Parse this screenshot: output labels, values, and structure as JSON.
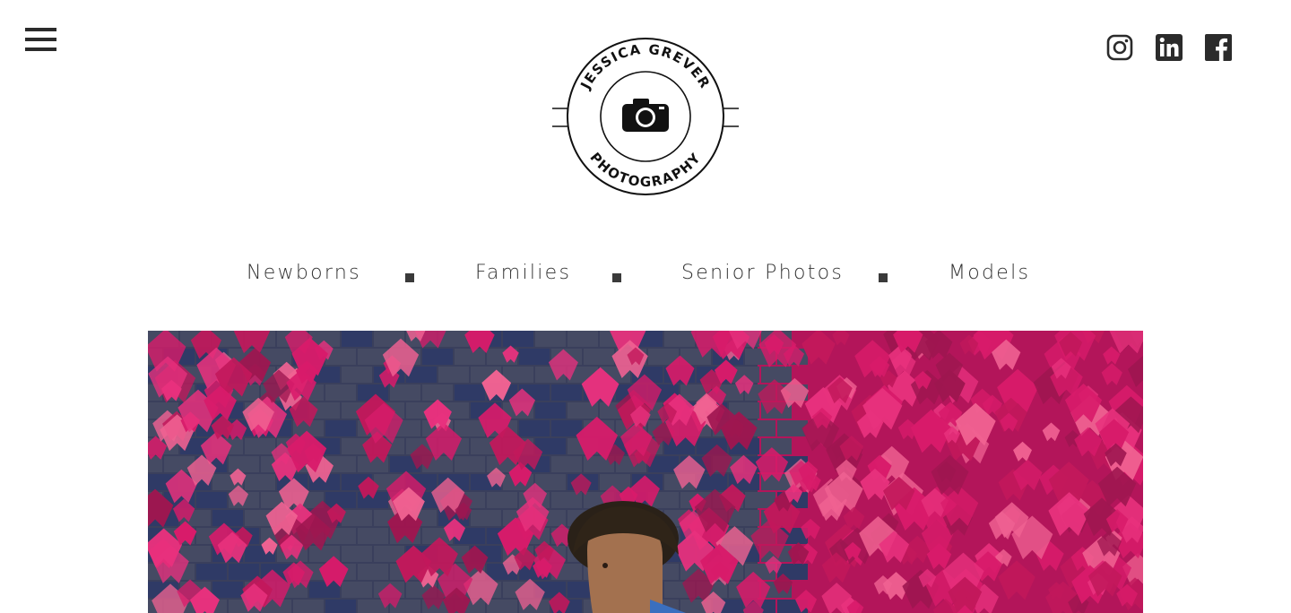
{
  "header": {
    "menu_icon": "hamburger-menu-icon",
    "logo": {
      "top_text": "JESSICA GREVER",
      "bottom_text": "PHOTOGRAPHY",
      "icon": "camera-icon"
    },
    "social": [
      {
        "name": "Instagram",
        "icon": "instagram-icon"
      },
      {
        "name": "LinkedIn",
        "icon": "linkedin-icon"
      },
      {
        "name": "Facebook",
        "icon": "facebook-icon"
      }
    ]
  },
  "nav": {
    "items": [
      {
        "label": "Newborns"
      },
      {
        "label": "Families"
      },
      {
        "label": "Senior Photos"
      },
      {
        "label": "Models"
      }
    ],
    "separator_icon": "square-bullet-icon"
  },
  "hero": {
    "image": "portrait-photo-ivy-wall",
    "colors": {
      "ivy": "#d81b6a",
      "ivy_dark": "#9e1650",
      "wall": "#3a3f5c"
    }
  }
}
